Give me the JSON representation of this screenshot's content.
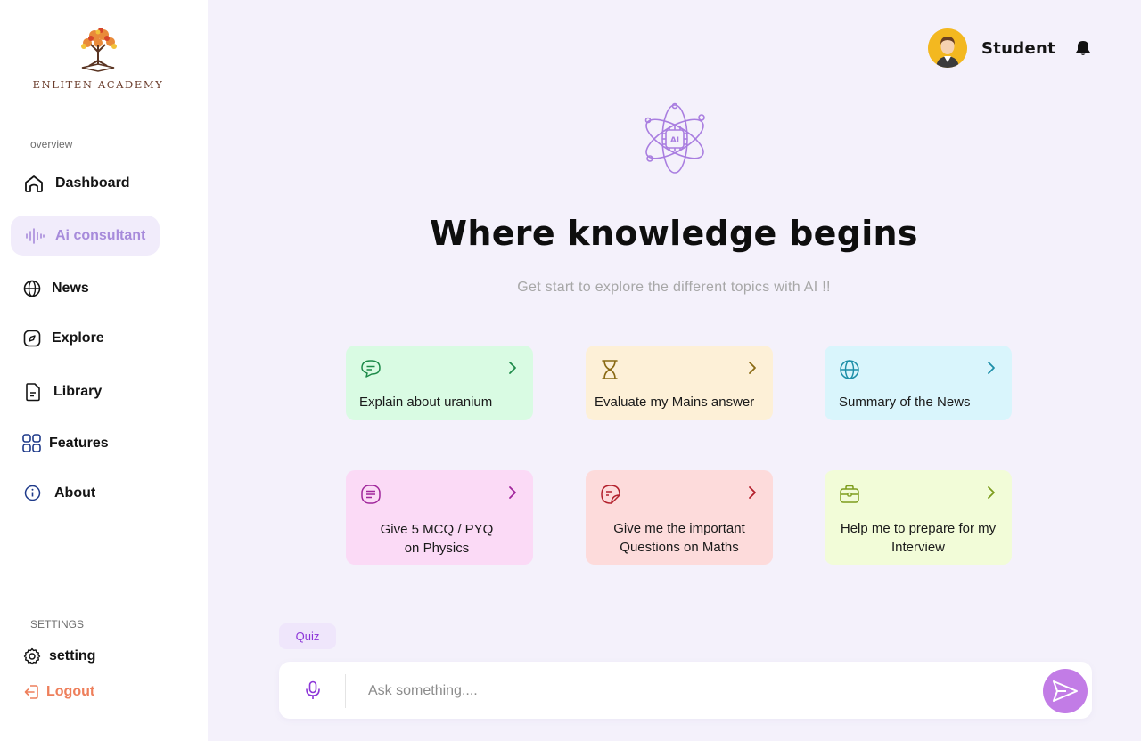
{
  "brand": {
    "name": "ENLITEN ACADEMY"
  },
  "sidebar": {
    "overview_label": "overview",
    "items": [
      {
        "label": "Dashboard",
        "icon": "home-icon"
      },
      {
        "label": "Ai consultant",
        "icon": "audio-wave-icon",
        "active": true
      },
      {
        "label": "News",
        "icon": "globe-icon"
      },
      {
        "label": "Explore",
        "icon": "compass-icon"
      },
      {
        "label": "Library",
        "icon": "document-icon"
      },
      {
        "label": "Features",
        "icon": "grid-icon"
      },
      {
        "label": "About",
        "icon": "info-icon"
      }
    ],
    "settings_label": "SETTINGS",
    "setting_label": "setting",
    "logout_label": "Logout"
  },
  "header": {
    "user_name": "Student"
  },
  "hero": {
    "title": "Where knowledge begins",
    "subtitle": "Get start to explore the different topics with AI !!"
  },
  "cards": [
    {
      "text": "Explain about uranium",
      "icon": "chat-bubble-icon",
      "color": "#d9fbe3",
      "accent": "#1d8a49"
    },
    {
      "text": "Evaluate my Mains answer",
      "icon": "hourglass-icon",
      "color": "#fdf0d7",
      "accent": "#8a6a14"
    },
    {
      "text": "Summary of the News",
      "icon": "globe-icon",
      "color": "#d9f5fc",
      "accent": "#1d8fa8"
    },
    {
      "text": "Give 5 MCQ / PYQ on Physics",
      "icon": "list-note-icon",
      "color": "#fbdaf6",
      "accent": "#a0259b"
    },
    {
      "text": "Give me the important Questions on Maths",
      "icon": "sticky-note-icon",
      "color": "#fddbdb",
      "accent": "#b3202c"
    },
    {
      "text": "Help me to prepare for my Interview",
      "icon": "briefcase-icon",
      "color": "#f2fcd8",
      "accent": "#7c9c1c"
    }
  ],
  "quiz": {
    "label": "Quiz"
  },
  "chat": {
    "placeholder": "Ask something...."
  }
}
